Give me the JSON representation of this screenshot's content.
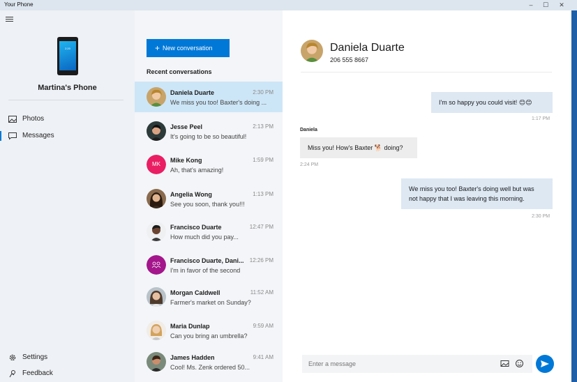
{
  "window": {
    "title": "Your Phone",
    "controls": [
      "–",
      "☐",
      "✕"
    ]
  },
  "nav": {
    "phone_clock": "2:20",
    "phone_name": "Martina's Phone",
    "items": [
      {
        "label": "Photos",
        "icon": "photos-icon"
      },
      {
        "label": "Messages",
        "icon": "messages-icon"
      }
    ],
    "bottom": [
      {
        "label": "Settings",
        "icon": "gear-icon"
      },
      {
        "label": "Feedback",
        "icon": "feedback-icon"
      }
    ]
  },
  "convlist": {
    "new_button": "New conversation",
    "new_plus": "+",
    "recent_title": "Recent conversations",
    "items": [
      {
        "name": "Daniela Duarte",
        "time": "2:30 PM",
        "preview": "We miss you too! Baxter's doing ...",
        "avatar": "photo"
      },
      {
        "name": "Jesse Peel",
        "time": "2:13 PM",
        "preview": "It's going to be so beautiful!",
        "avatar": "photo"
      },
      {
        "name": "Mike Kong",
        "time": "1:59 PM",
        "preview": "Ah, that's amazing!",
        "avatar": "initials",
        "initials": "MK",
        "color": "#e91e63"
      },
      {
        "name": "Angelia Wong",
        "time": "1:13 PM",
        "preview": "See you soon, thank you!!!",
        "avatar": "photo"
      },
      {
        "name": "Francisco Duarte",
        "time": "12:47 PM",
        "preview": "How much did you pay...",
        "avatar": "photo"
      },
      {
        "name": "Francisco Duarte, Dani...",
        "time": "12:26 PM",
        "preview": "I'm in favor of the second",
        "avatar": "group",
        "color": "#a4168c"
      },
      {
        "name": "Morgan Caldwell",
        "time": "11:52 AM",
        "preview": "Farmer's market on Sunday?",
        "avatar": "photo"
      },
      {
        "name": "Maria Dunlap",
        "time": "9:59 AM",
        "preview": "Can you bring an umbrella?",
        "avatar": "photo"
      },
      {
        "name": "James Hadden",
        "time": "9:41 AM",
        "preview": "Cool! Ms. Zenk ordered 50...",
        "avatar": "photo"
      }
    ]
  },
  "chat": {
    "contact_name": "Daniela Duarte",
    "contact_phone": "206 555 8667",
    "messages": [
      {
        "dir": "out",
        "text": "I'm so happy you could visit!",
        "emoji": "😊😊",
        "time": "1:17 PM"
      },
      {
        "dir": "in",
        "sender": "Daniela",
        "text_before": "Miss you! How's Baxter",
        "emoji": "🐕",
        "text_after": "doing?",
        "time": "2:24 PM"
      },
      {
        "dir": "out",
        "line1": "We miss you too! Baxter's doing well but was",
        "line2": "not happy that I was leaving this morning.",
        "time": "2:30 PM"
      }
    ],
    "input_placeholder": "Enter a message",
    "icons": [
      "image-icon",
      "emoji-icon",
      "send-icon"
    ]
  },
  "colors": {
    "accent": "#0078d7",
    "selected": "#cde6f7",
    "out_bubble": "#dde8f3",
    "in_bubble": "#ededed"
  }
}
